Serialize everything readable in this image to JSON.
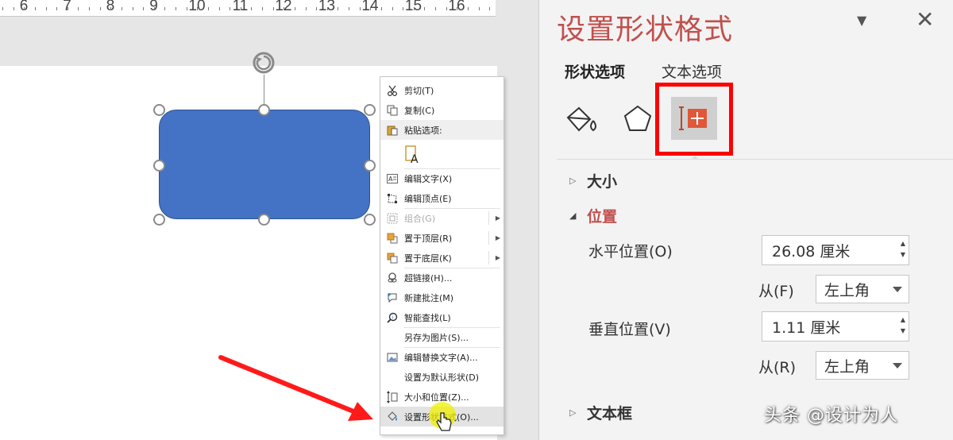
{
  "ruler": {
    "numbers": [
      "6",
      "7",
      "8",
      "9",
      "10",
      "11",
      "12",
      "13",
      "14",
      "15",
      "16"
    ]
  },
  "context_menu": {
    "items": [
      {
        "label": "剪切(T)",
        "icon": "scissors-icon"
      },
      {
        "label": "复制(C)",
        "icon": "copy-icon"
      },
      {
        "label": "粘贴选项:",
        "icon": "paste-icon"
      },
      {
        "label": "",
        "icon": "paste-keep-text-icon"
      },
      {
        "label": "编辑文字(X)",
        "icon": "edit-text-icon"
      },
      {
        "label": "编辑顶点(E)",
        "icon": "edit-points-icon"
      },
      {
        "label": "组合(G)",
        "icon": "group-icon"
      },
      {
        "label": "置于顶层(R)",
        "icon": "bring-front-icon"
      },
      {
        "label": "置于底层(K)",
        "icon": "send-back-icon"
      },
      {
        "label": "超链接(H)...",
        "icon": "hyperlink-icon"
      },
      {
        "label": "新建批注(M)",
        "icon": "new-comment-icon"
      },
      {
        "label": "智能查找(L)",
        "icon": "smart-lookup-icon"
      },
      {
        "label": "另存为图片(S)...",
        "icon": ""
      },
      {
        "label": "编辑替换文字(A)...",
        "icon": "alt-text-icon"
      },
      {
        "label": "设置为默认形状(D)",
        "icon": ""
      },
      {
        "label": "大小和位置(Z)...",
        "icon": "size-position-icon"
      },
      {
        "label": "设置形状格式(O)...",
        "icon": "format-shape-icon"
      }
    ]
  },
  "pane": {
    "title": "设置形状格式",
    "tab_shape": "形状选项",
    "tab_text": "文本选项",
    "sections": {
      "size": "大小",
      "position": "位置",
      "textbox": "文本框"
    },
    "horizontal": {
      "label": "水平位置(O)",
      "value": "26.08 厘米",
      "from_label": "从(F)",
      "from_value": "左上角"
    },
    "vertical": {
      "label": "垂直位置(V)",
      "value": "1.11 厘米",
      "from_label": "从(R)",
      "from_value": "左上角"
    }
  },
  "colors": {
    "shape_fill": "#4472c4",
    "accent": "#c0504d",
    "highlight_box": "#ff0000"
  },
  "watermark": "头条 @设计为人"
}
